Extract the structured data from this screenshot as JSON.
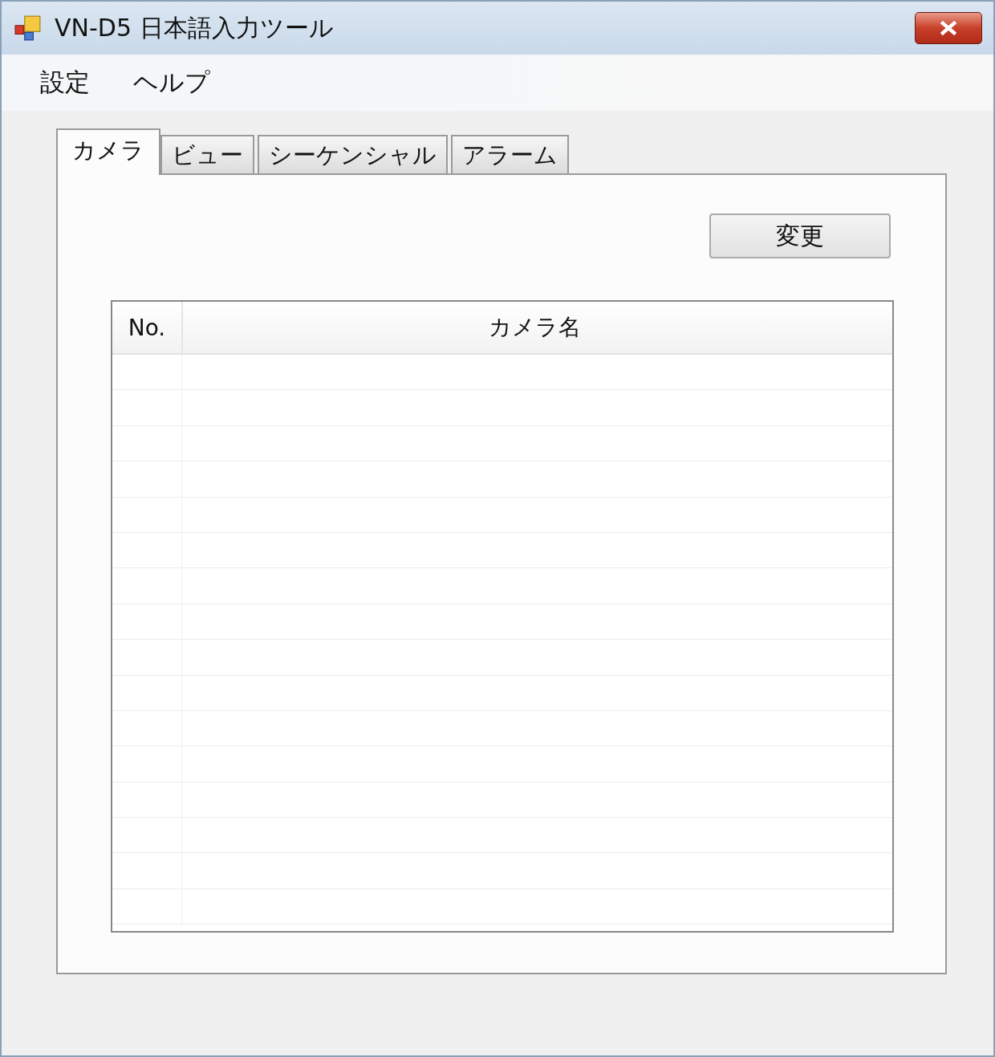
{
  "window": {
    "title": "VN-D5 日本語入力ツール"
  },
  "menu": [
    {
      "label": "設定"
    },
    {
      "label": "ヘルプ"
    }
  ],
  "tabs": [
    {
      "label": "カメラ",
      "selected": true
    },
    {
      "label": "ビュー",
      "selected": false
    },
    {
      "label": "シーケンシャル",
      "selected": false
    },
    {
      "label": "アラーム",
      "selected": false
    }
  ],
  "buttons": [
    {
      "label": "変更"
    }
  ],
  "table": {
    "columns": [
      "No.",
      "カメラ名"
    ]
  }
}
